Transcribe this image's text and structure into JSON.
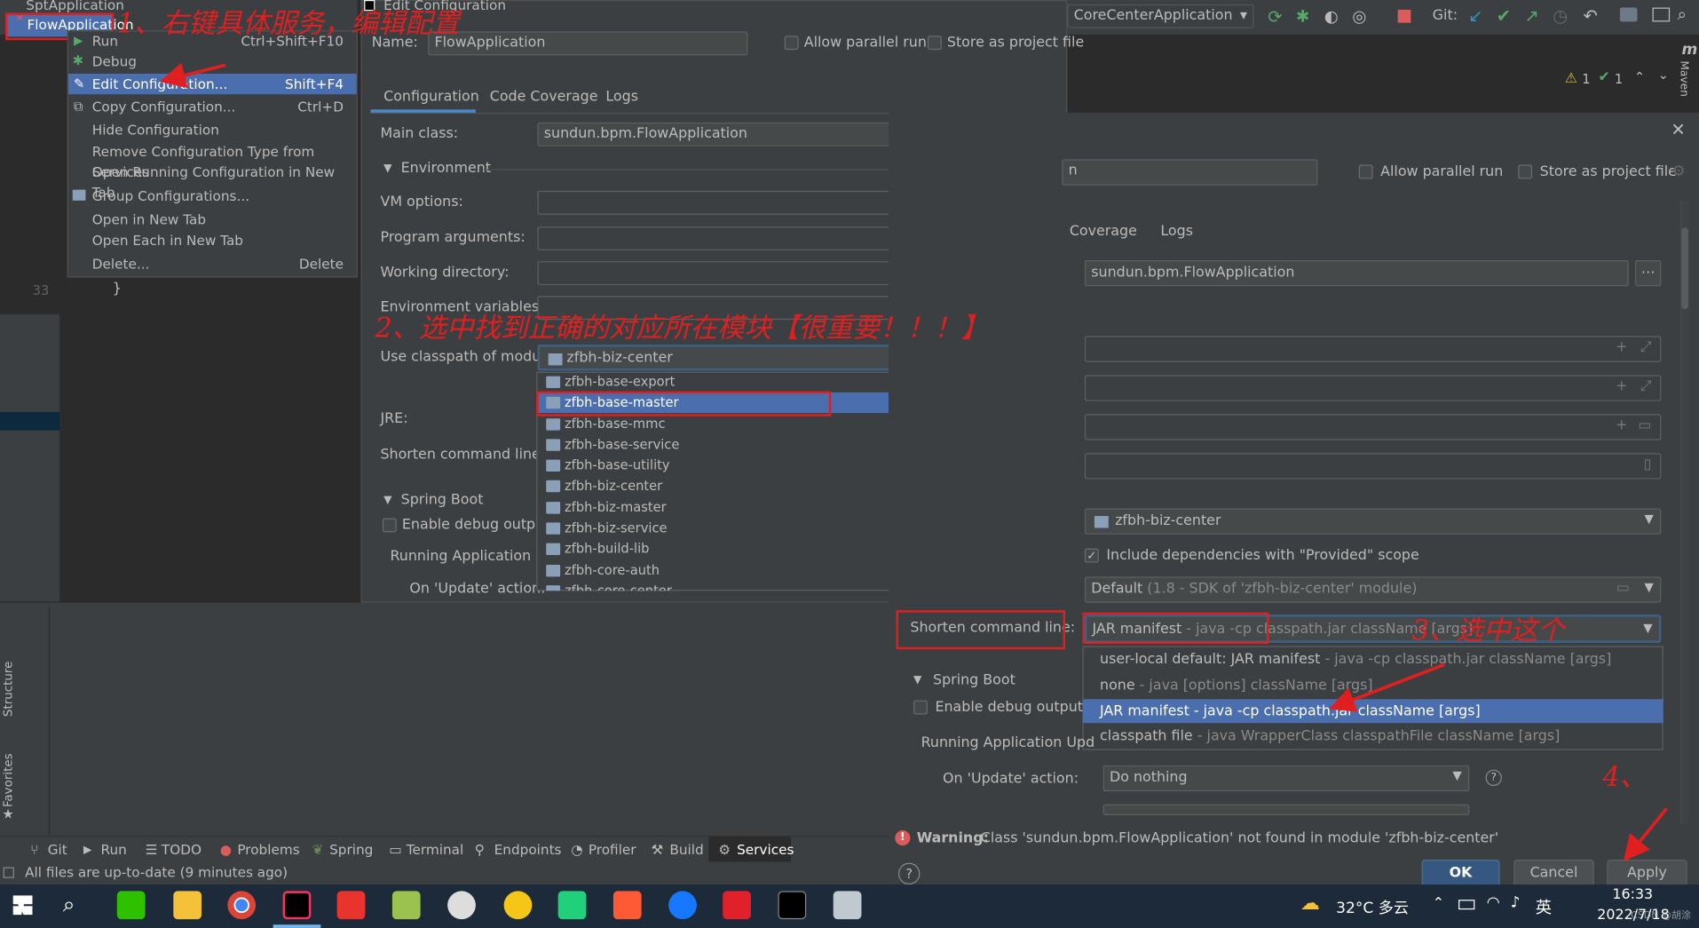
{
  "toolbar": {
    "run_config": "CoreCenterApplication",
    "git_label": "Git:",
    "warn_count": "1",
    "ok_count": "1",
    "maven_label": "Maven"
  },
  "left_top": {
    "spt_app": "SptApplication",
    "flow_app": "FlowApplication"
  },
  "context_menu": {
    "items": [
      {
        "label": "Run",
        "shortcut": "Ctrl+Shift+F10"
      },
      {
        "label": "Debug",
        "shortcut": ""
      },
      {
        "label": "Edit Configuration...",
        "shortcut": "Shift+F4"
      },
      {
        "label": "Copy Configuration...",
        "shortcut": "Ctrl+D"
      },
      {
        "label": "Hide Configuration",
        "shortcut": ""
      },
      {
        "label": "Remove Configuration Type from Services",
        "shortcut": ""
      },
      {
        "label": "Open Running Configuration in New Tab",
        "shortcut": ""
      },
      {
        "label": "Group Configurations...",
        "shortcut": ""
      },
      {
        "label": "Open in New Tab",
        "shortcut": ""
      },
      {
        "label": "Open Each in New Tab",
        "shortcut": ""
      },
      {
        "label": "Delete...",
        "shortcut": "Delete"
      }
    ]
  },
  "editor": {
    "line_number": "33",
    "code": "}"
  },
  "dialog1": {
    "title": "Edit Configuration",
    "name_label": "Name:",
    "name_value": "FlowApplication",
    "allow_parallel": "Allow parallel run",
    "store_project": "Store as project file",
    "tabs": [
      "Configuration",
      "Code Coverage",
      "Logs"
    ],
    "main_class_label": "Main class:",
    "main_class_value": "sundun.bpm.FlowApplication",
    "environment": "Environment",
    "vm_options": "VM options:",
    "program_args": "Program arguments:",
    "working_dir": "Working directory:",
    "env_vars": "Environment variables:",
    "classpath_label": "Use classpath of module:",
    "classpath_value": "zfbh-biz-center",
    "jre_label": "JRE:",
    "shorten_label": "Shorten command line:",
    "spring_boot": "Spring Boot",
    "enable_debug": "Enable debug output",
    "running_update": "Running Application Upd",
    "on_update": "On 'Update' action:",
    "modules": [
      "zfbh-base-export",
      "zfbh-base-master",
      "zfbh-base-mmc",
      "zfbh-base-service",
      "zfbh-base-utility",
      "zfbh-biz-center",
      "zfbh-biz-master",
      "zfbh-biz-service",
      "zfbh-build-lib",
      "zfbh-core-auth",
      "zfbh-core-center"
    ]
  },
  "dialog2": {
    "name_tail": "n",
    "allow_parallel": "Allow parallel run",
    "store_project": "Store as project file",
    "tab_coverage": "Coverage",
    "tab_logs": "Logs",
    "main_class_value": "sundun.bpm.FlowApplication",
    "classpath_value": "zfbh-biz-center",
    "include_deps": "Include dependencies with \"Provided\" scope",
    "jre_value": "Default",
    "jre_hint": "(1.8 - SDK of 'zfbh-biz-center' module)",
    "shorten_label": "Shorten command line:",
    "shorten_value": "JAR manifest",
    "shorten_hint": "- java -cp classpath.jar className [args]",
    "options": [
      {
        "main": "user-local default: JAR manifest",
        "hint": "- java -cp classpath.jar className [args]"
      },
      {
        "main": "none",
        "hint": "- java [options] className [args]"
      },
      {
        "main": "JAR manifest - java -cp classpath.jar className [args]",
        "hint": ""
      },
      {
        "main": "classpath file",
        "hint": "- java WrapperClass classpathFile className [args]"
      }
    ],
    "spring_boot": "Spring Boot",
    "enable_debug": "Enable debug output",
    "running_update": "Running Application Upd",
    "on_update": "On 'Update' action:",
    "on_update_value": "Do nothing",
    "warning_bold": "Warning:",
    "warning_text": "Class 'sundun.bpm.FlowApplication' not found in module 'zfbh-biz-center'",
    "ok": "OK",
    "cancel": "Cancel",
    "apply": "Apply"
  },
  "annotations": {
    "a1": "1、右键具体服务，编辑配置",
    "a2": "2、选中找到正确的对应所在模块【很重要！！！】",
    "a3": "3、选中这个",
    "a4": "4、"
  },
  "bottom_tools": [
    "Git",
    "Run",
    "TODO",
    "Problems",
    "Spring",
    "Terminal",
    "Endpoints",
    "Profiler",
    "Build",
    "Services"
  ],
  "side_tools": [
    "Structure",
    "Favorites"
  ],
  "status": "All files are up-to-date (9 minutes ago)",
  "taskbar": {
    "weather": "32°C 多云",
    "ime": "英",
    "time": "16:33",
    "date": "2022/7/18",
    "watermark": "CSDN @胡涂"
  },
  "colors": {
    "selection": "#4b6eaf",
    "annotation": "#e02020",
    "dialog_bg": "#3c3f41"
  }
}
